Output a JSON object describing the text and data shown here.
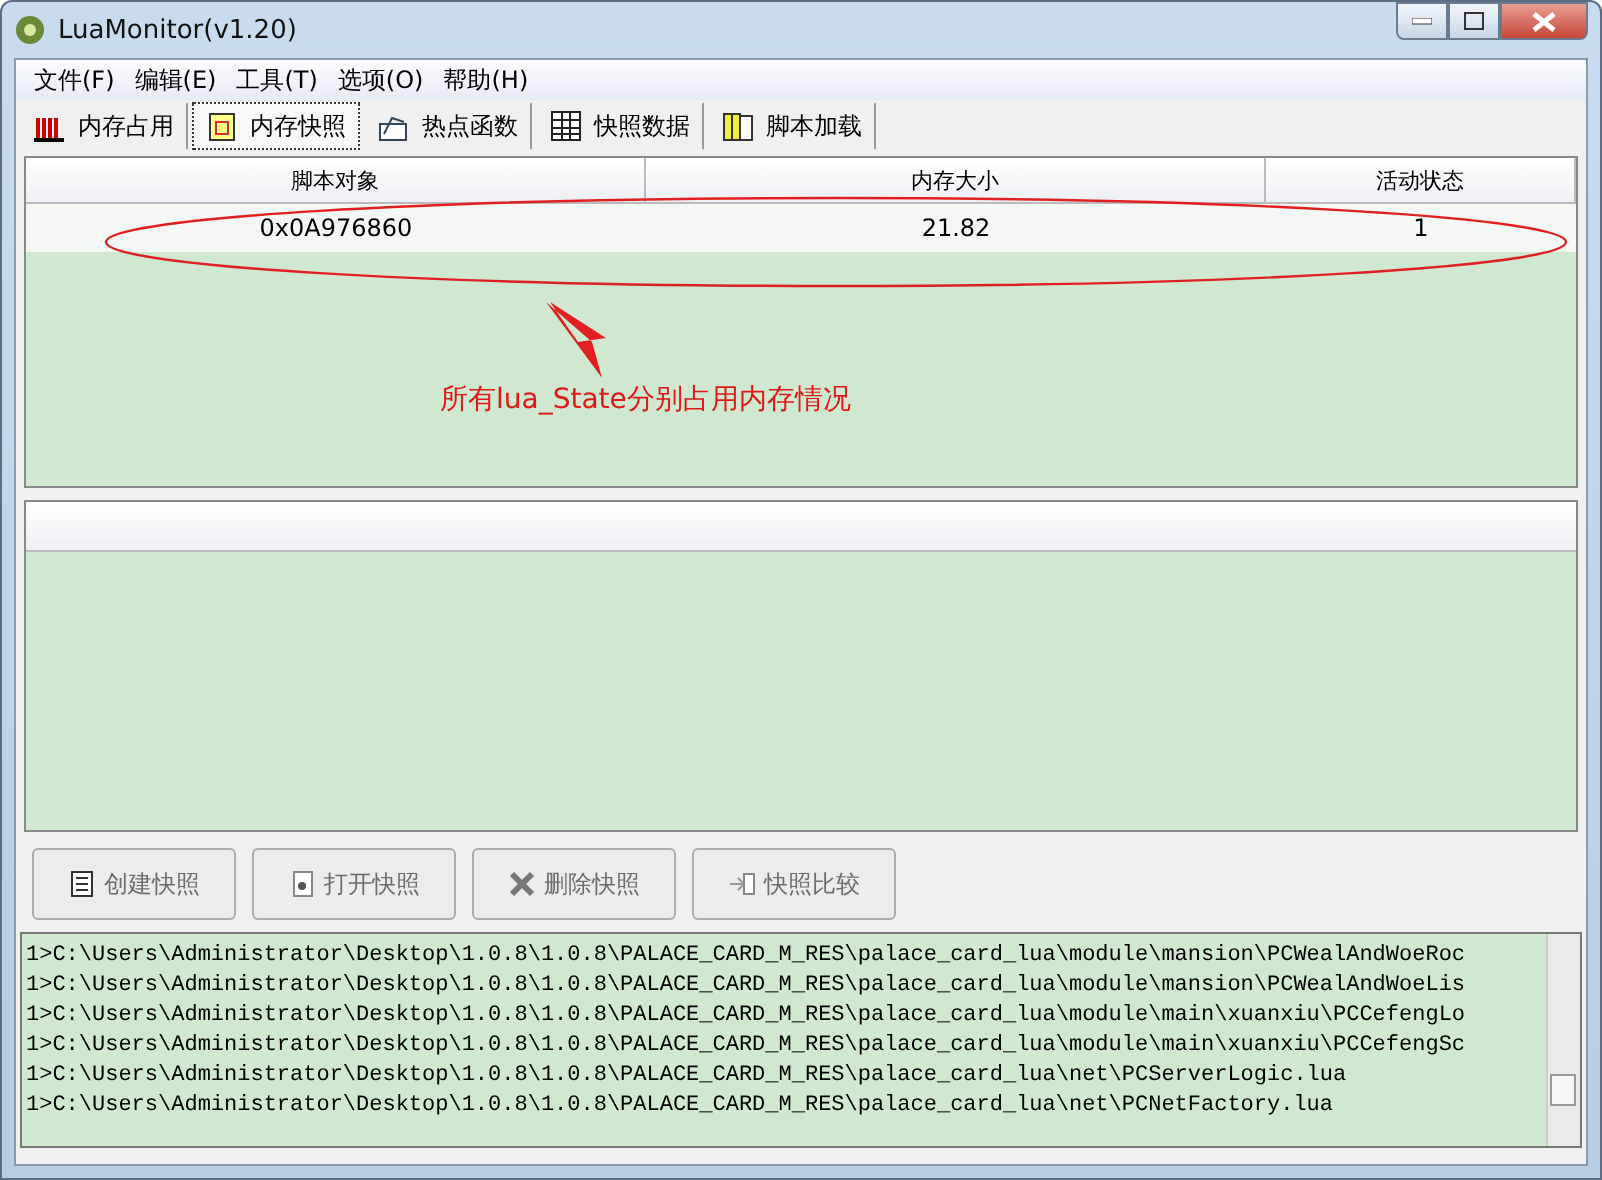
{
  "window": {
    "title": "LuaMonitor(v1.20)"
  },
  "menu": [
    "文件(F)",
    "编辑(E)",
    "工具(T)",
    "选项(O)",
    "帮助(H)"
  ],
  "tabs": [
    {
      "label": "内存占用",
      "selected": false
    },
    {
      "label": "内存快照",
      "selected": true
    },
    {
      "label": "热点函数",
      "selected": false
    },
    {
      "label": "快照数据",
      "selected": false
    },
    {
      "label": "脚本加载",
      "selected": false
    }
  ],
  "table": {
    "columns": [
      "脚本对象",
      "内存大小",
      "活动状态"
    ],
    "rows": [
      [
        "0x0A976860",
        "21.82",
        "1"
      ]
    ]
  },
  "annotation": {
    "text": "所有lua_State分别占用内存情况"
  },
  "buttons": [
    {
      "label": "创建快照",
      "disabled": true
    },
    {
      "label": "打开快照",
      "disabled": true
    },
    {
      "label": "删除快照",
      "disabled": true
    },
    {
      "label": "快照比较",
      "disabled": true
    }
  ],
  "log": [
    "1>C:\\Users\\Administrator\\Desktop\\1.0.8\\1.0.8\\PALACE_CARD_M_RES\\palace_card_lua\\module\\mansion\\PCWealAndWoeRoc",
    "1>C:\\Users\\Administrator\\Desktop\\1.0.8\\1.0.8\\PALACE_CARD_M_RES\\palace_card_lua\\module\\mansion\\PCWealAndWoeLis",
    "1>C:\\Users\\Administrator\\Desktop\\1.0.8\\1.0.8\\PALACE_CARD_M_RES\\palace_card_lua\\module\\main\\xuanxiu\\PCCefengLo",
    "1>C:\\Users\\Administrator\\Desktop\\1.0.8\\1.0.8\\PALACE_CARD_M_RES\\palace_card_lua\\module\\main\\xuanxiu\\PCCefengSc",
    "1>C:\\Users\\Administrator\\Desktop\\1.0.8\\1.0.8\\PALACE_CARD_M_RES\\palace_card_lua\\net\\PCServerLogic.lua",
    "1>C:\\Users\\Administrator\\Desktop\\1.0.8\\1.0.8\\PALACE_CARD_M_RES\\palace_card_lua\\net\\PCNetFactory.lua"
  ]
}
